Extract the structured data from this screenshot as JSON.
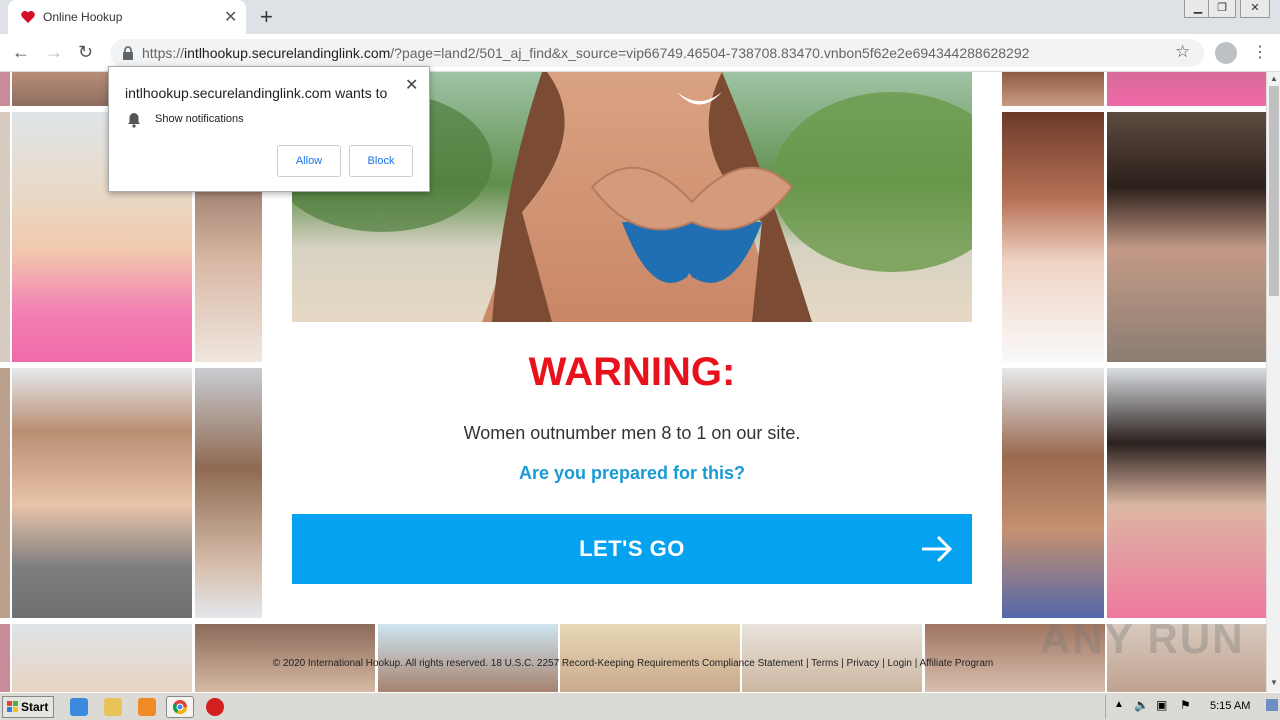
{
  "browser": {
    "tab_title": "Online Hookup",
    "url_domain": "intlhookup.securelandinglink.com",
    "url_rest": "/?page=land2/501_aj_find&x_source=vip66749.46504-738708.83470.vnbon5f62e2e694344288628292",
    "url_scheme": "https://"
  },
  "notification": {
    "title": "intlhookup.securelandinglink.com wants to",
    "permission": "Show notifications",
    "allow_label": "Allow",
    "block_label": "Block"
  },
  "page": {
    "warning": "WARNING:",
    "subtext": "Women outnumber men 8 to 1 on our site.",
    "question": "Are you prepared for this?",
    "cta_label": "LET'S GO",
    "footer": "© 2020 International Hookup. All rights reserved. 18 U.S.C. 2257 Record-Keeping Requirements Compliance Statement | Terms | Privacy | Login  |  Affiliate Program",
    "watermark": "ANY RUN"
  },
  "taskbar": {
    "start_label": "Start",
    "clock": "5:15 AM"
  },
  "colors": {
    "warning_red": "#e8121c",
    "question_blue": "#1a9ad6",
    "cta_blue": "#05a2f0"
  }
}
